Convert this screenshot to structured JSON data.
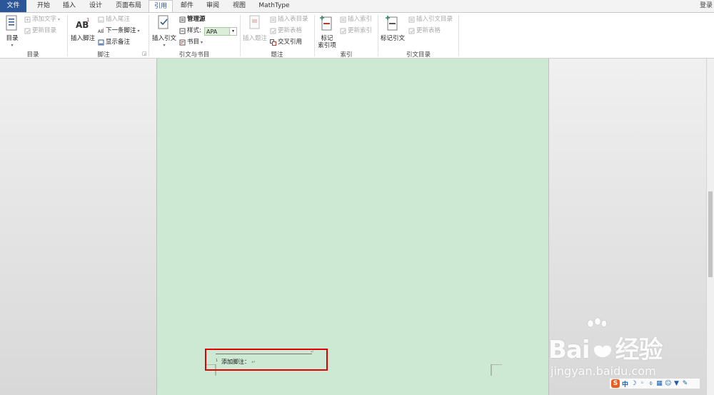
{
  "tabs": {
    "file": "文件",
    "home": "开始",
    "insert": "插入",
    "design": "设计",
    "layout": "页面布局",
    "references": "引用",
    "mailings": "邮件",
    "review": "审阅",
    "view": "视图",
    "mathtype": "MathType",
    "login": "登录"
  },
  "ribbon": {
    "toc": {
      "big": "目录",
      "add_text": "添加文字",
      "update_toc": "更新目录",
      "label": "目录"
    },
    "footnotes": {
      "insert_footnote": "插入脚注",
      "insert_endnote": "插入尾注",
      "next_footnote": "下一条脚注",
      "show_notes": "显示备注",
      "label": "脚注"
    },
    "citations": {
      "insert_citation": "插入引文",
      "manage_sources": "管理源",
      "style_label": "样式:",
      "style_value": "APA",
      "bibliography": "书目",
      "label": "引文与书目"
    },
    "captions": {
      "insert_caption": "插入题注",
      "insert_table_of_figures": "插入表目录",
      "update_table": "更新表格",
      "cross_reference": "交叉引用",
      "label": "题注"
    },
    "index": {
      "mark_entry": "标记\n索引项",
      "insert_index": "插入索引",
      "update_index": "更新索引",
      "label": "索引"
    },
    "toa": {
      "mark_citation": "标记引文",
      "insert_toa": "插入引文目录",
      "update_table": "更新表格",
      "label": "引文目录"
    }
  },
  "document": {
    "footnote_number": "1",
    "footnote_text": "添加脚注："
  },
  "watermark": {
    "brand": "Bai",
    "brand2": "经验",
    "url": "jingyan.baidu.com"
  },
  "ime": {
    "logo": "S",
    "mode": "中"
  },
  "colors": {
    "file_tab": "#2b579a",
    "page_background": "#cde9d3",
    "highlight_box": "#e00000"
  }
}
